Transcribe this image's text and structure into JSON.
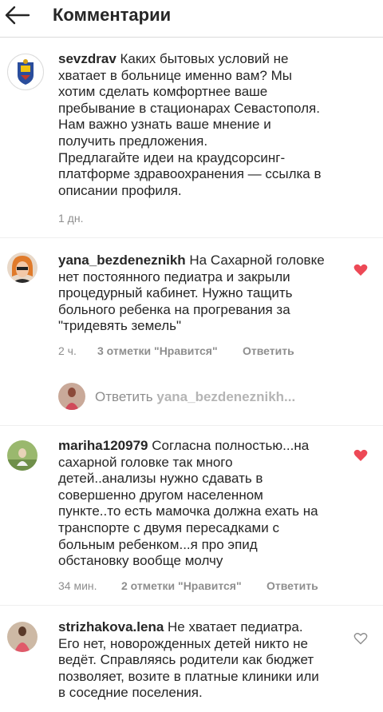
{
  "header": {
    "title": "Комментарии"
  },
  "caption": {
    "username": "sevzdrav",
    "text": "Каких бытовых условий не хватает в больнице именно вам? Мы хотим сделать комфортнее ваше пребывание в стационарах Севастополя. Нам важно узнать ваше мнение и получить предложения.",
    "text2": "Предлагайте идеи на краудсорсинг-платформе здравоохранения — ссылка в описании профиля.",
    "time": "1 дн."
  },
  "comments": [
    {
      "username": "yana_bezdeneznikh",
      "text": "На Сахарной головке нет постоянного педиатра и закрыли процедурный кабинет. Нужно тащить больного ребенка на прогревания за \"тридевять земель\"",
      "time": "2 ч.",
      "likes": "3 отметки \"Нравится\"",
      "reply": "Ответить",
      "liked": true
    },
    {
      "username": "mariha120979",
      "text": "Согласна полностью...на сахарной головке так много детей..анализы нужно сдавать в совершенно другом населенном пункте..то есть мамочка должна ехать на транспорте с двумя пересадками с больным ребенком...я про эпид обстановку вообще молчу",
      "time": "34 мин.",
      "likes": "2 отметки \"Нравится\"",
      "reply": "Ответить",
      "liked": true
    },
    {
      "username": "strizhakova.lena",
      "text": "Не хватает педиатра. Его нет, новорожденных детей никто не ведёт. Справляясь родители как бюджет позволяет, возите в платные клиники или в соседние поселения.",
      "liked": false
    }
  ],
  "reply_prompt": {
    "prefix": "Ответить ",
    "username": "yana_bezdeneznikh..."
  },
  "colors": {
    "heart_liked": "#ed4956",
    "secondary": "#8e8e8e",
    "text": "#262626"
  }
}
